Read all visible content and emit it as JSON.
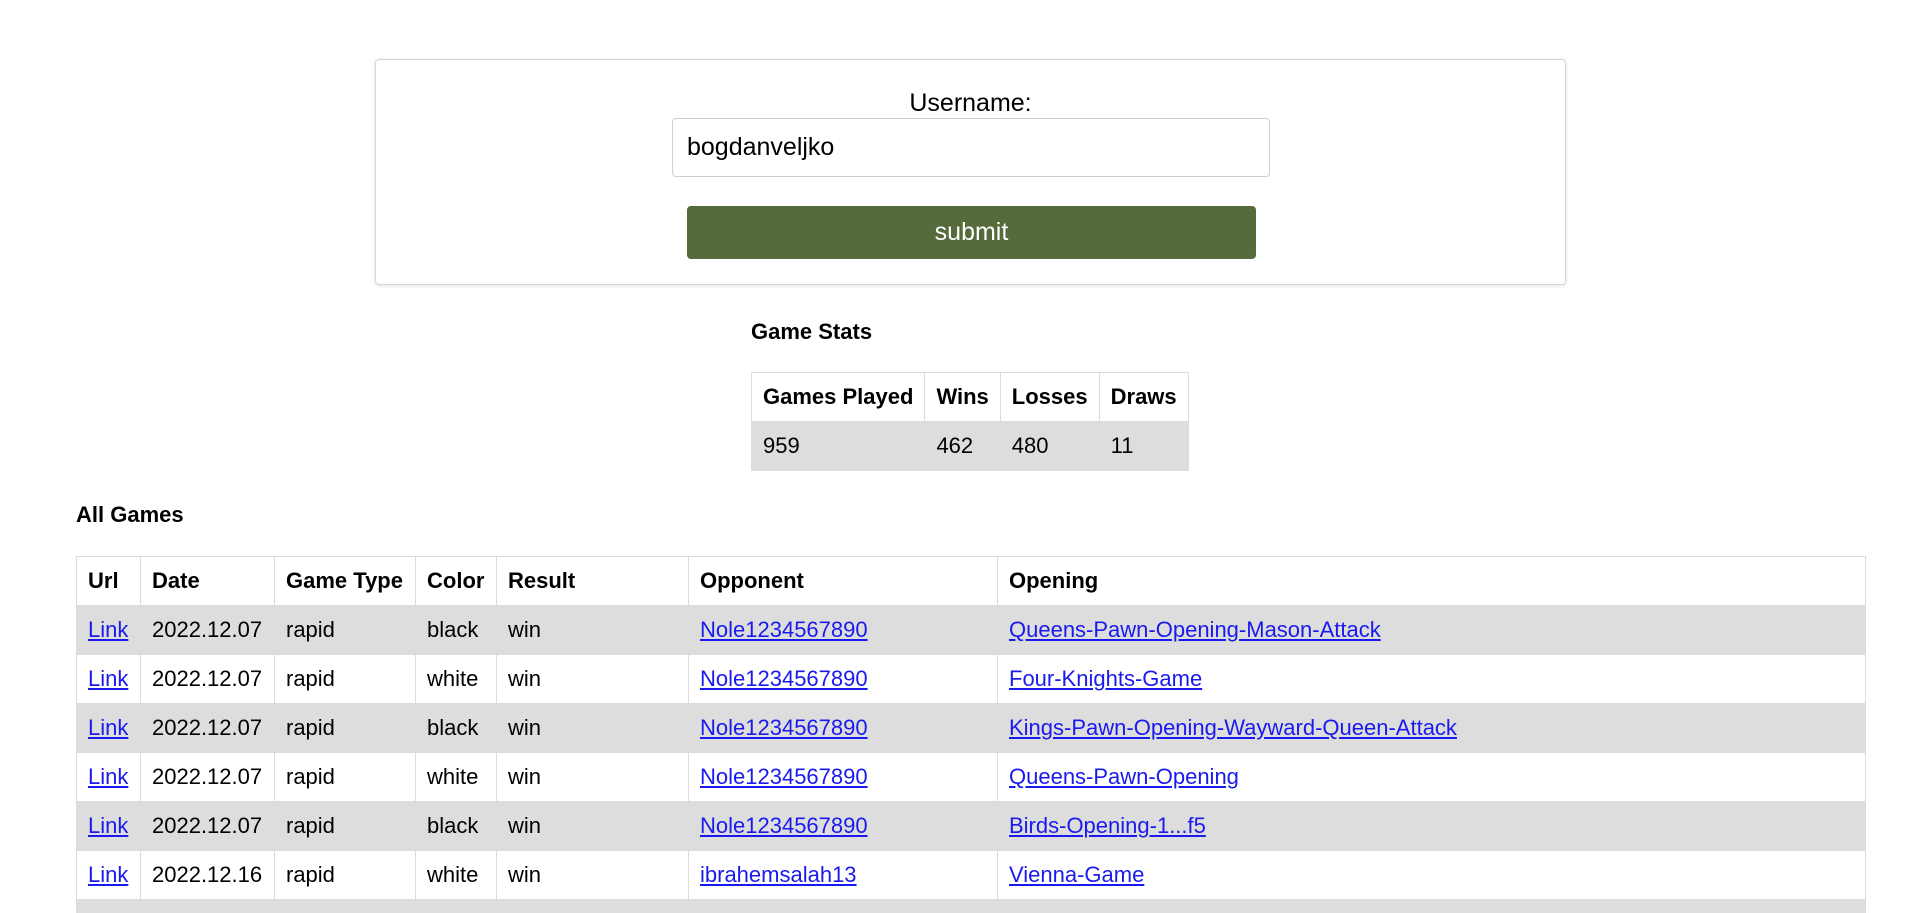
{
  "form": {
    "label": "Username:",
    "value": "bogdanveljko",
    "submit_label": "submit"
  },
  "stats": {
    "heading": "Game Stats",
    "headers": [
      "Games Played",
      "Wins",
      "Losses",
      "Draws"
    ],
    "values": [
      "959",
      "462",
      "480",
      "11"
    ]
  },
  "games": {
    "heading": "All Games",
    "headers": [
      "Url",
      "Date",
      "Game Type",
      "Color",
      "Result",
      "Opponent",
      "Opening"
    ],
    "rows": [
      {
        "url": "Link",
        "date": "2022.12.07",
        "type": "rapid",
        "color": "black",
        "result": "win",
        "opponent": "Nole1234567890",
        "opening": "Queens-Pawn-Opening-Mason-Attack"
      },
      {
        "url": "Link",
        "date": "2022.12.07",
        "type": "rapid",
        "color": "white",
        "result": "win",
        "opponent": "Nole1234567890",
        "opening": "Four-Knights-Game"
      },
      {
        "url": "Link",
        "date": "2022.12.07",
        "type": "rapid",
        "color": "black",
        "result": "win",
        "opponent": "Nole1234567890",
        "opening": "Kings-Pawn-Opening-Wayward-Queen-Attack"
      },
      {
        "url": "Link",
        "date": "2022.12.07",
        "type": "rapid",
        "color": "white",
        "result": "win",
        "opponent": "Nole1234567890",
        "opening": "Queens-Pawn-Opening"
      },
      {
        "url": "Link",
        "date": "2022.12.07",
        "type": "rapid",
        "color": "black",
        "result": "win",
        "opponent": "Nole1234567890",
        "opening": "Birds-Opening-1...f5"
      },
      {
        "url": "Link",
        "date": "2022.12.16",
        "type": "rapid",
        "color": "white",
        "result": "win",
        "opponent": "ibrahemsalah13",
        "opening": "Vienna-Game"
      },
      {
        "url": "",
        "date": "",
        "type": "",
        "color": "",
        "result": "",
        "opponent": "",
        "opening": ""
      }
    ]
  },
  "colors": {
    "submit_bg": "#556b3b",
    "row_stripe": "#dddddd",
    "link": "#1a1aee"
  }
}
